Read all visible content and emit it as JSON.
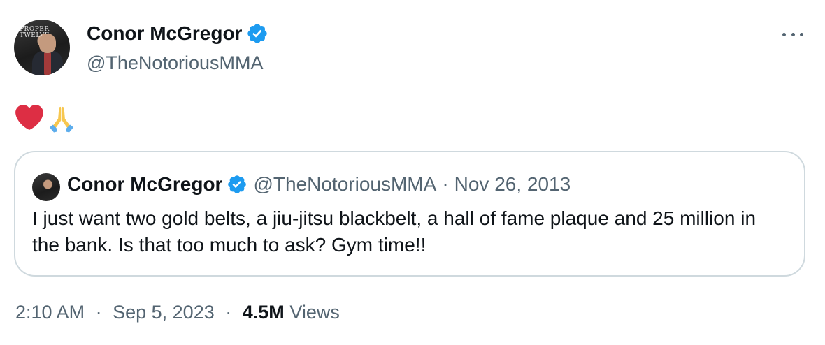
{
  "tweet": {
    "author": {
      "display_name": "Conor McGregor",
      "handle": "@TheNotoriousMMA",
      "verified": true,
      "avatar_icon": "profile-photo",
      "avatar_sign": "PROPER TWELVE"
    },
    "more_icon": "more-options-icon",
    "body_emojis": [
      "❤️",
      "🙏"
    ],
    "quoted": {
      "display_name": "Conor McGregor",
      "handle": "@TheNotoriousMMA",
      "separator": "·",
      "date": "Nov 26, 2013",
      "text": "I just want two gold belts, a jiu-jitsu blackbelt, a hall of fame plaque and 25 million in the bank. Is that too much to ask? Gym time!!"
    },
    "meta": {
      "time": "2:10 AM",
      "separator": "·",
      "date": "Sep 5, 2023",
      "views_count": "4.5M",
      "views_label": "Views"
    }
  },
  "colors": {
    "verified_blue": "#1d9bf0",
    "secondary_text": "#536471",
    "primary_text": "#0f1419",
    "border": "#cfd9de"
  }
}
